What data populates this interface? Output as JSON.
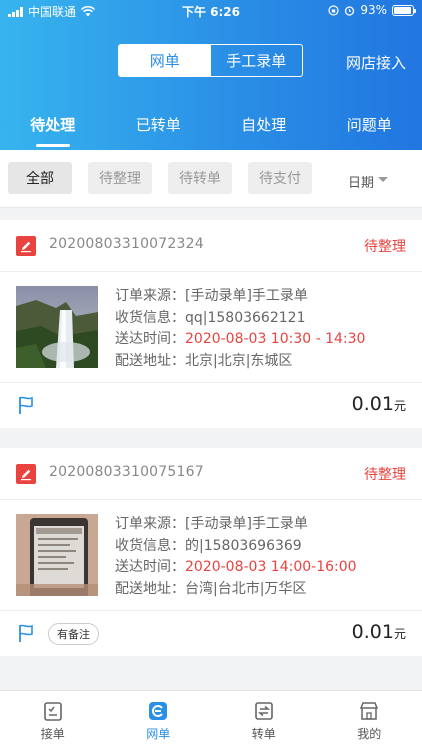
{
  "status_bar": {
    "carrier": "中国联通",
    "time": "下午 6:26",
    "battery": "93%",
    "battery_level": 0.93
  },
  "header": {
    "segments": [
      "网单",
      "手工录单"
    ],
    "active_segment": 0,
    "shop_link": "网店接入",
    "tabs": [
      "待处理",
      "已转单",
      "自处理",
      "问题单"
    ],
    "active_tab": 0
  },
  "filters": {
    "chips": [
      "全部",
      "待整理",
      "待转单",
      "待支付"
    ],
    "date_label": "日期"
  },
  "labels": {
    "source": "订单来源：",
    "receiver": "收货信息：",
    "delivery_time": "送达时间：",
    "address": "配送地址："
  },
  "orders": [
    {
      "order_no": "20200803310072324",
      "status": "待整理",
      "source": "[手动录单]手工录单",
      "receiver": "qq|15803662121",
      "delivery_time": "2020-08-03 10:30 - 14:30",
      "address": "北京|北京|东城区",
      "amount": "0.01",
      "currency": "元"
    },
    {
      "order_no": "20200803310075167",
      "status": "待整理",
      "source": "[手动录单]手工录单",
      "receiver": "的|15803696369",
      "delivery_time": "2020-08-03 14:00-16:00",
      "address": "台湾|台北市|万华区",
      "amount": "0.01",
      "currency": "元",
      "note_tag": "有备注"
    }
  ],
  "tabbar": [
    "接单",
    "网单",
    "转单",
    "我的"
  ],
  "colors": {
    "accent": "#2a8fe6",
    "status_red": "#e8433f"
  }
}
